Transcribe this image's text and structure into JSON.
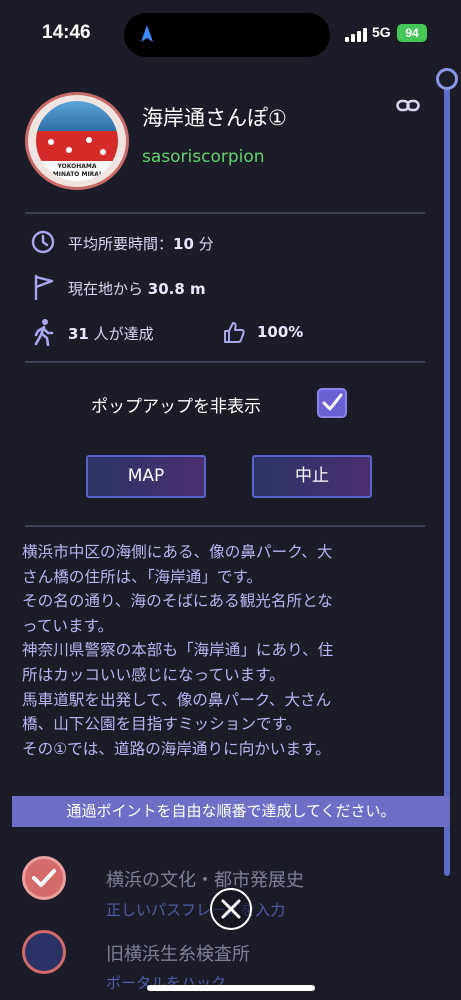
{
  "status_bar": {
    "time": "14:46",
    "network": "5G",
    "battery": "94"
  },
  "header": {
    "title": "海岸通さんぽ①",
    "author": "sasoriscorpion",
    "avatar_text_line1": "YOKOHAMA",
    "avatar_text_line2": "MINATO MIRAI"
  },
  "stats": {
    "avg_time_label": "平均所要時間：",
    "avg_time_value": "10",
    "avg_time_unit": "分",
    "distance_label": "現在地から",
    "distance_value": "30.8 m",
    "achieved_count": "31",
    "achieved_label": "人が達成",
    "rating": "100%"
  },
  "popup": {
    "label": "ポップアップを非表示",
    "checked": true
  },
  "buttons": {
    "map": "MAP",
    "stop": "中止"
  },
  "description": [
    "横浜市中区の海側にある、像の鼻パーク、大",
    "さん橋の住所は、「海岸通」です。",
    "その名の通り、海のそばにある観光名所とな",
    "っています。",
    "神奈川県警察の本部も「海岸通」にあり、住",
    "所はカッコいい感じになっています。",
    "馬車道駅を出発して、像の鼻パーク、大さん",
    "橋、山下公園を目指すミッションです。",
    "その①では、道路の海岸通りに向かいます。"
  ],
  "banner": "通過ポイントを自由な順番で達成してください。",
  "tasks": [
    {
      "title": "横浜の文化・都市発展史",
      "subtitle": "正しいパスフレーズを入力"
    },
    {
      "title": "旧横浜生糸検査所",
      "subtitle": "ポータルをハック"
    }
  ],
  "colors": {
    "background": "#1c1c28",
    "accent": "#6e6ec6",
    "author": "#5fd46a",
    "button_border": "#5a63c8"
  },
  "icons": [
    "location-arrow-icon",
    "signal-icon",
    "battery-icon",
    "link-icon",
    "clock-icon",
    "flag-icon",
    "walker-icon",
    "thumbs-up-icon",
    "checkmark-icon",
    "close-icon"
  ]
}
